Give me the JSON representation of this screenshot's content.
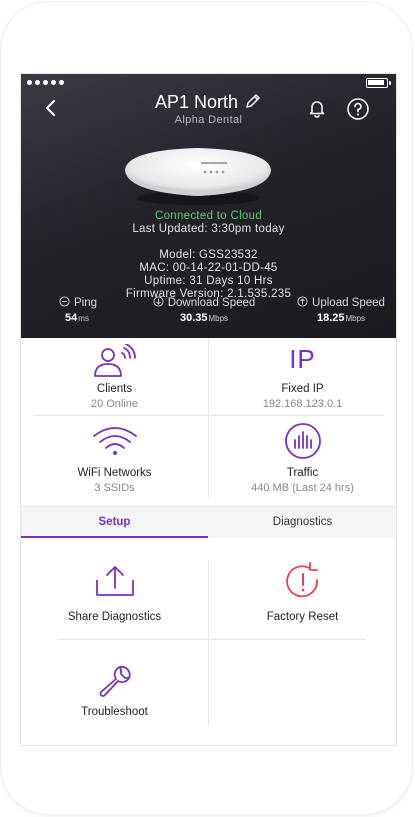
{
  "header": {
    "title": "AP1 North",
    "subtitle": "Alpha Dental"
  },
  "device": {
    "status": "Connected to Cloud",
    "last_updated": "Last Updated: 3:30pm today",
    "model": "Model: GSS23532",
    "mac": "MAC: 00-14-22-01-DD-45",
    "uptime": "Uptime: 31 Days 10 Hrs",
    "firmware": "Firmware Version: 2.1.535.235"
  },
  "speeds": {
    "ping_label": "Ping",
    "ping_value": "54",
    "ping_unit": "ms",
    "download_label": "Download Speed",
    "download_value": "30.35",
    "download_unit": "Mbps",
    "upload_label": "Upload Speed",
    "upload_value": "18.25",
    "upload_unit": "Mbps"
  },
  "tiles": [
    {
      "name": "Clients",
      "sub": "20 Online",
      "icon": "clients-icon"
    },
    {
      "name": "Fixed IP",
      "sub": "192.168.123.0.1",
      "icon_text": "IP"
    },
    {
      "name": "WiFi Networks",
      "sub": "3 SSIDs",
      "icon": "wifi-icon"
    },
    {
      "name": "Traffic",
      "sub": "440 MB (Last 24 hrs)",
      "icon": "traffic-icon"
    }
  ],
  "tabs": [
    {
      "label": "Setup",
      "active": true
    },
    {
      "label": "Diagnostics",
      "active": false
    }
  ],
  "actions": [
    {
      "label": "Share Diagnostics",
      "icon": "share-icon"
    },
    {
      "label": "Factory Reset",
      "icon": "factory-reset-icon"
    },
    {
      "label": "Troubleshoot",
      "icon": "wrench-icon"
    }
  ],
  "colors": {
    "accent": "#7a2fc6",
    "connected": "#53d06a",
    "reset": "#e8404c"
  }
}
